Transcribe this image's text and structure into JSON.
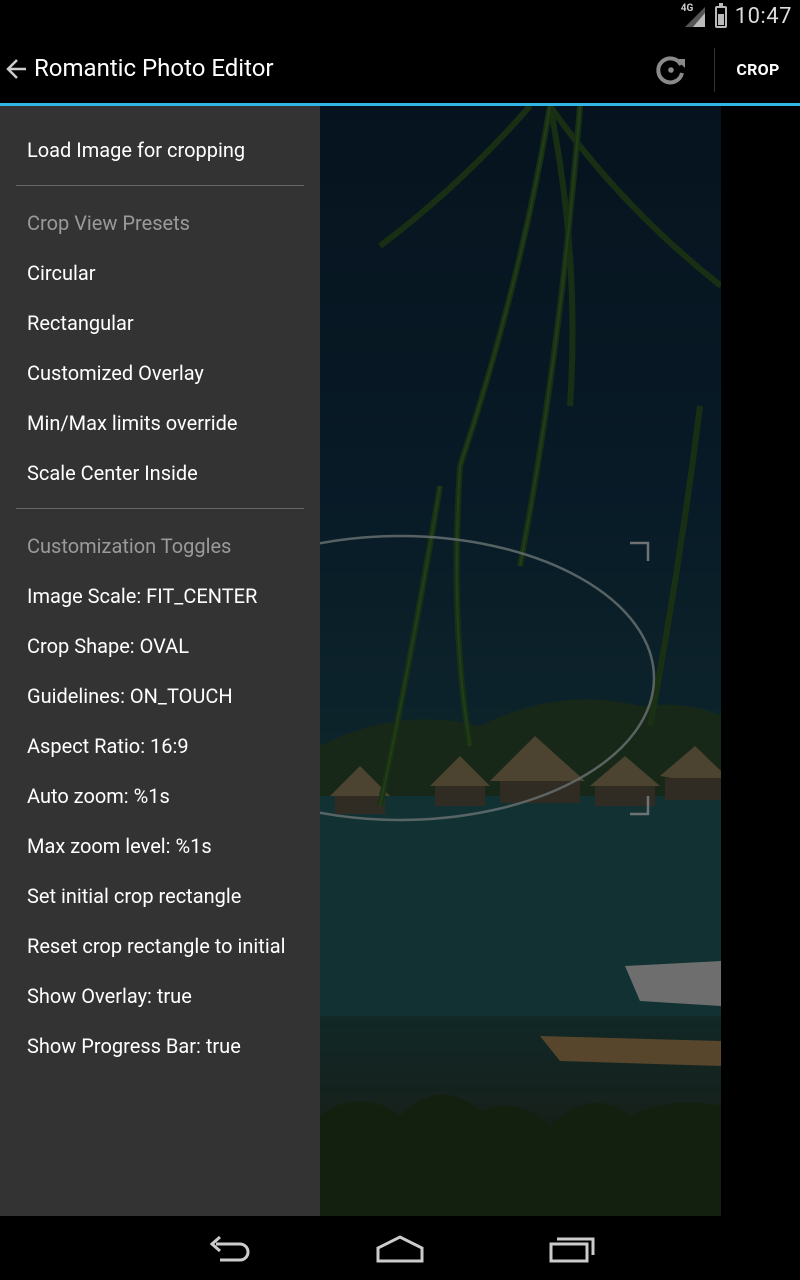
{
  "status_bar": {
    "network": "4G",
    "time": "10:47"
  },
  "action_bar": {
    "title": "Romantic Photo Editor",
    "crop_label": "CROP"
  },
  "drawer": {
    "load_item": "Load Image for cropping",
    "presets_header": "Crop View Presets",
    "presets": [
      "Circular",
      "Rectangular",
      "Customized Overlay",
      "Min/Max limits override",
      "Scale Center Inside"
    ],
    "toggles_header": "Customization Toggles",
    "toggles": [
      "Image Scale: FIT_CENTER",
      "Crop Shape: OVAL",
      "Guidelines: ON_TOUCH",
      "Aspect Ratio: 16:9",
      "Auto zoom: %1s",
      "Max zoom level: %1s",
      "Set initial crop rectangle",
      "Reset crop rectangle to initial",
      "Show Overlay: true",
      "Show Progress Bar: true"
    ]
  },
  "colors": {
    "accent": "#33b5e5",
    "drawer_bg": "#333333",
    "header_text": "#9a9a9a"
  },
  "icons": [
    "back-arrow-icon",
    "rotate-icon",
    "nav-back-icon",
    "nav-home-icon",
    "nav-recents-icon"
  ]
}
